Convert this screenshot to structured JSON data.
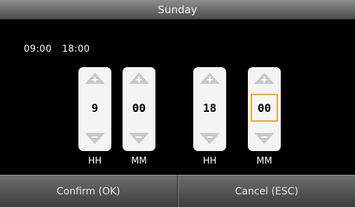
{
  "window": {
    "title": "Sunday"
  },
  "summary": {
    "start": "09:00",
    "end": "18:00"
  },
  "pickers": [
    {
      "value": "9",
      "unit": "HH"
    },
    {
      "value": "00",
      "unit": "MM"
    },
    {
      "value": "18",
      "unit": "HH"
    },
    {
      "value": "00",
      "unit": "MM"
    }
  ],
  "buttons": {
    "confirm": "Confirm (OK)",
    "cancel": "Cancel (ESC)"
  },
  "colors": {
    "focus": "#f0a81e",
    "spinner_bg": "#f4f4f4",
    "titlebar": "#6f6f6f"
  }
}
